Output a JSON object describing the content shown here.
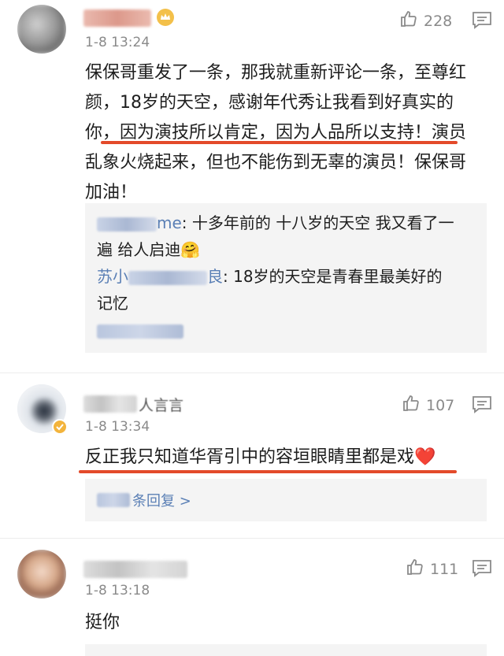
{
  "comments": [
    {
      "name_suffix_icon": "crown-icon",
      "time": "1-8 13:24",
      "likes": "228",
      "text_lines": [
        "保保哥重发了一条，那我就重新评论一条，至尊红",
        "颜，18岁的天空，感谢年代秀让我看到好真实的",
        "你，因为演技所以肯定，因为人品所以支持！演员",
        "乱象火烧起来，但也不能伤到无辜的演员！保保哥",
        "加油！"
      ],
      "replies": [
        {
          "name_visible": "me",
          "text": ": 十多年前的 十八岁的天空  我又看了一",
          "text2": "遍  给人启迪🤗"
        },
        {
          "name_visible": "苏小",
          "name_visible2": "良",
          "text": ": 18岁的天空是青春里最美好的",
          "text2": "记忆"
        }
      ]
    },
    {
      "name_visible": "人言言",
      "time": "1-8 13:34",
      "likes": "107",
      "text": "反正我只知道华胥引中的容垣眼睛里都是戏❤️",
      "more_replies": "条回复 >"
    },
    {
      "time": "1-8 13:18",
      "likes": "111",
      "text": "挺你"
    }
  ],
  "colors": {
    "accent_underline": "#e34a2a",
    "link": "#5a7fb5",
    "meta": "#8a8a8a"
  }
}
